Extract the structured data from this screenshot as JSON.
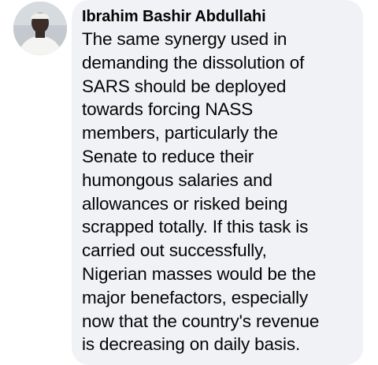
{
  "comment": {
    "author": "Ibrahim Bashir Abdullahi",
    "text": "The same synergy used in\ndemanding the dissolution of\nSARS should be deployed\ntowards forcing NASS\nmembers, particularly the\nSenate to reduce their\nhumongous salaries and\nallowances or risked being\nscrapped totally. If this task is\ncarried out successfully,\nNigerian masses would be the\nmajor benefactors, especially\nnow that the country's revenue\nis decreasing on daily basis."
  },
  "colors": {
    "bubble_background": "#f0f2f5",
    "text": "#050505"
  }
}
